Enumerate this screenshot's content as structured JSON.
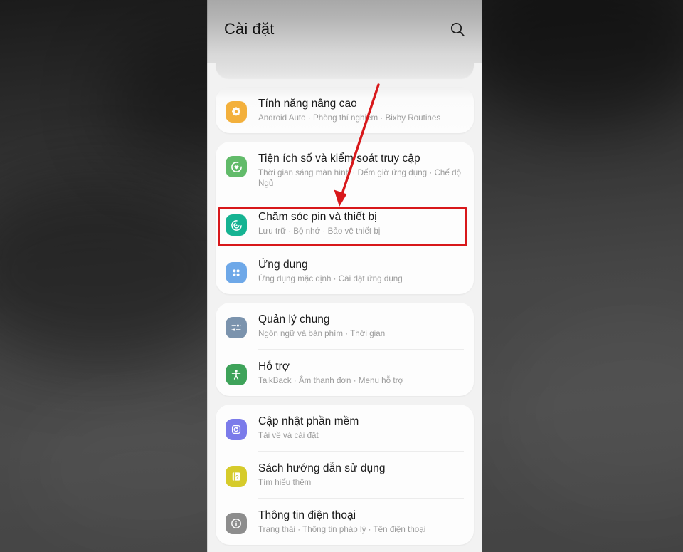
{
  "header": {
    "title": "Cài đặt",
    "search_icon": "search-icon"
  },
  "annotations": {
    "arrow_color": "#d8181b",
    "highlight_color": "#d8181b",
    "highlight_target": "Chăm sóc pin và thiết bị"
  },
  "groups": [
    {
      "group_name": "advanced-group",
      "items": [
        {
          "title": "Tính năng nâng cao",
          "subtitle": "Android Auto  ·  Phòng thí nghiệm  ·  Bixby Routines",
          "icon": "advanced-features-icon",
          "icon_color": "#f3b03c"
        }
      ]
    },
    {
      "group_name": "wellbeing-apps-group",
      "items": [
        {
          "title": "Tiện ích số và kiểm soát truy cập",
          "subtitle": "Thời gian sáng màn hình  ·  Đếm giờ ứng dụng  ·  Chế độ Ngủ",
          "icon": "digital-wellbeing-icon",
          "icon_color": "#62bb6a"
        },
        {
          "title": "Chăm sóc pin và thiết bị",
          "subtitle": "Lưu trữ  ·  Bộ nhớ  ·  Bảo vệ thiết bị",
          "icon": "device-care-icon",
          "icon_color": "#15b392",
          "highlighted": true
        },
        {
          "title": "Ứng dụng",
          "subtitle": "Ứng dụng mặc định  ·  Cài đặt ứng dụng",
          "icon": "apps-grid-icon",
          "icon_color": "#6ea8e8"
        }
      ]
    },
    {
      "group_name": "management-group",
      "items": [
        {
          "title": "Quản lý chung",
          "subtitle": "Ngôn ngữ và bàn phím  ·  Thời gian",
          "icon": "general-management-sliders-icon",
          "icon_color": "#7b93ad"
        },
        {
          "title": "Hỗ trợ",
          "subtitle": "TalkBack  ·  Âm thanh đơn  ·  Menu hỗ trợ",
          "icon": "accessibility-person-icon",
          "icon_color": "#3ea35a"
        }
      ]
    },
    {
      "group_name": "system-group",
      "items": [
        {
          "title": "Cập nhật phần mềm",
          "subtitle": "Tải về và cài đặt",
          "icon": "software-update-refresh-icon",
          "icon_color": "#7b7bea"
        },
        {
          "title": "Sách hướng dẫn sử dụng",
          "subtitle": "Tìm hiểu thêm",
          "icon": "user-manual-book-icon",
          "icon_color": "#d6cb2b"
        },
        {
          "title": "Thông tin điện thoại",
          "subtitle": "Trạng thái  ·  Thông tin pháp lý  ·  Tên điện thoại",
          "icon": "phone-info-icon",
          "icon_color": "#8d8d8d"
        }
      ]
    }
  ]
}
